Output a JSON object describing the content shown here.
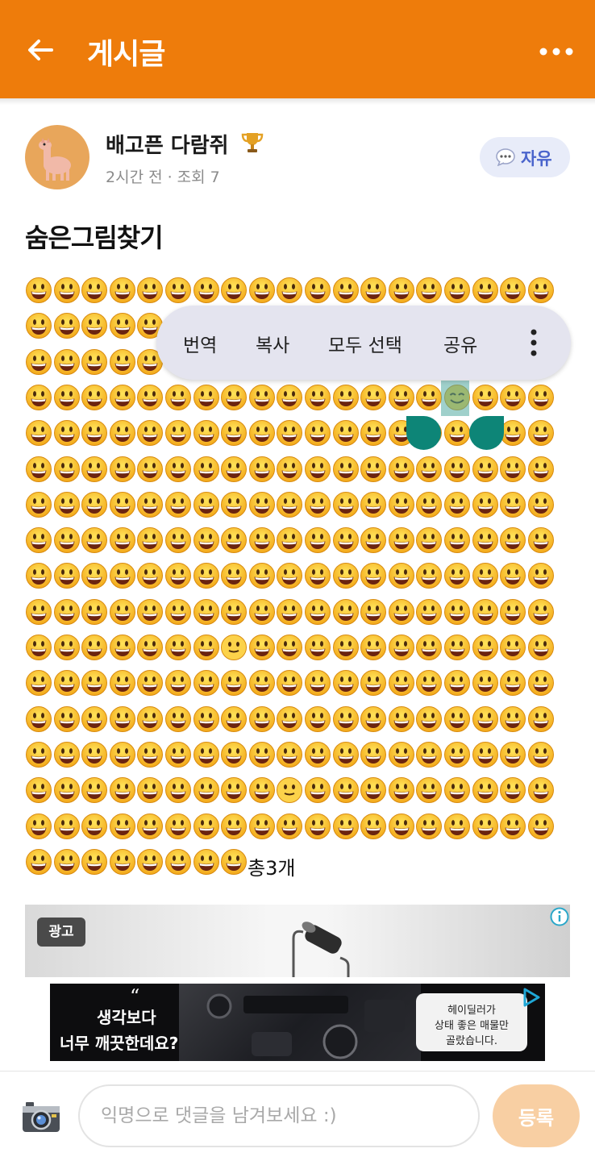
{
  "header": {
    "title": "게시글",
    "back_icon": "arrow-left-icon",
    "more_icon": "more-horizontal-icon",
    "background_color": "#ee7c0b"
  },
  "post": {
    "author": {
      "name": "배고픈 다람쥐",
      "avatar_icon": "llama-avatar",
      "badge_icon": "trophy-icon"
    },
    "meta": "2시간 전 · 조회 7",
    "category": {
      "label": "자유",
      "icon": "speech-bubble-icon"
    },
    "title": "숨은그림찾기",
    "grid": {
      "main_emoji": "grinning-face",
      "odd_emoji": [
        "smiling-face-eyes",
        "neutral-smile-face",
        "neutral-smile-face"
      ],
      "tail_text": "총3개"
    }
  },
  "context_menu": {
    "items": [
      "번역",
      "복사",
      "모두 선택",
      "공유"
    ],
    "more_icon": "more-vertical-icon"
  },
  "ad": {
    "label": "광고",
    "info_icon": "info-icon",
    "quote": "“",
    "headline_1": "생각보다",
    "headline_2": "너무 깨끗한데요?",
    "bubble_lines": [
      "헤이딜러가",
      "상태 좋은 매물만",
      "골랐습니다."
    ],
    "adchoices_icon": "adchoices-icon"
  },
  "comment_bar": {
    "camera_icon": "camera-icon",
    "placeholder": "익명으로 댓글을 남겨보세요 :)",
    "value": "",
    "submit_label": "등록",
    "submit_color": "#f8cfa3"
  }
}
